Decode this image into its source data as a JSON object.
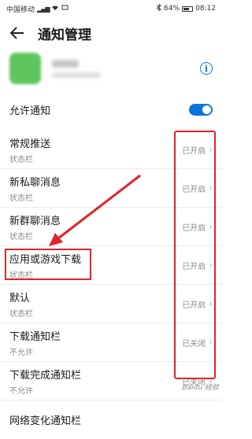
{
  "status_bar": {
    "carrier": "中国移动",
    "battery": "64%",
    "time": "08:12"
  },
  "header": {
    "title": "通知管理"
  },
  "allow": {
    "label": "允许通知",
    "enabled": true
  },
  "items": [
    {
      "title": "常规推送",
      "sub": "状态栏",
      "status": "已开启"
    },
    {
      "title": "新私聊消息",
      "sub": "状态栏",
      "status": "已开启"
    },
    {
      "title": "新群聊消息",
      "sub": "状态栏",
      "status": "已开启"
    },
    {
      "title": "应用或游戏下载",
      "sub": "状态栏",
      "status": "已开启"
    },
    {
      "title": "默认",
      "sub": "状态栏",
      "status": "已开启"
    },
    {
      "title": "下载通知栏",
      "sub": "不允许",
      "status": "已关闭"
    },
    {
      "title": "下载完成通知栏",
      "sub": "不允许",
      "status": "已关闭"
    },
    {
      "title": "网络变化通知栏",
      "sub": "",
      "status": ""
    }
  ],
  "colors": {
    "accent": "#0a75d8",
    "highlight": "#e0242a"
  },
  "watermark": "Baidu 经验"
}
